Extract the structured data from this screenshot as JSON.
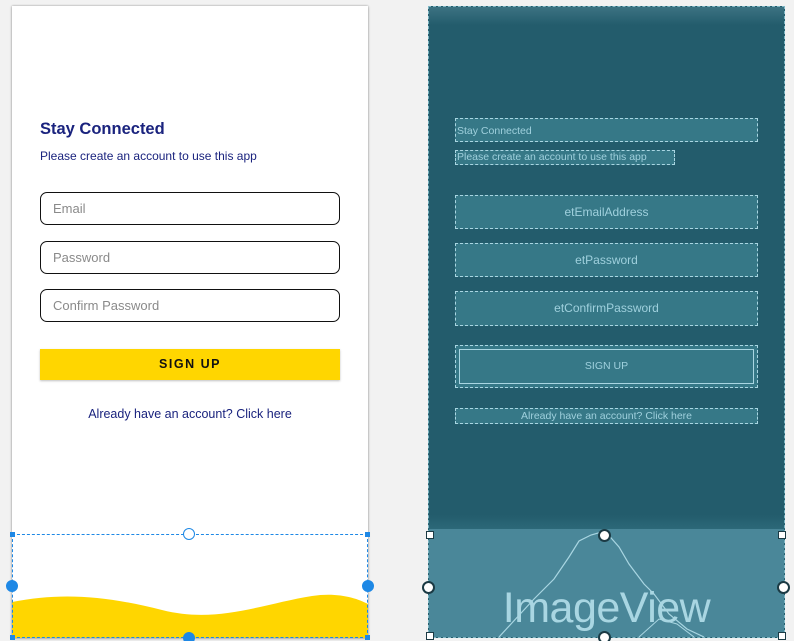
{
  "design": {
    "title": "Stay Connected",
    "subtitle": "Please create an account to use this app",
    "email_placeholder": "Email",
    "password_placeholder": "Password",
    "confirm_placeholder": "Confirm Password",
    "signup_label": "SIGN UP",
    "signin_link": "Already have an account? Click here",
    "wave_color": "#ffd600",
    "accent": "#1a237e"
  },
  "blueprint": {
    "title": "Stay Connected",
    "subtitle": "Please create an account to use this app",
    "email_id": "etEmailAddress",
    "password_id": "etPassword",
    "confirm_id": "etConfirmPassword",
    "signup_label": "SIGN UP",
    "signin_link": "Already have an account? Click here",
    "image_label": "ImageView",
    "background": "#235c6c"
  }
}
